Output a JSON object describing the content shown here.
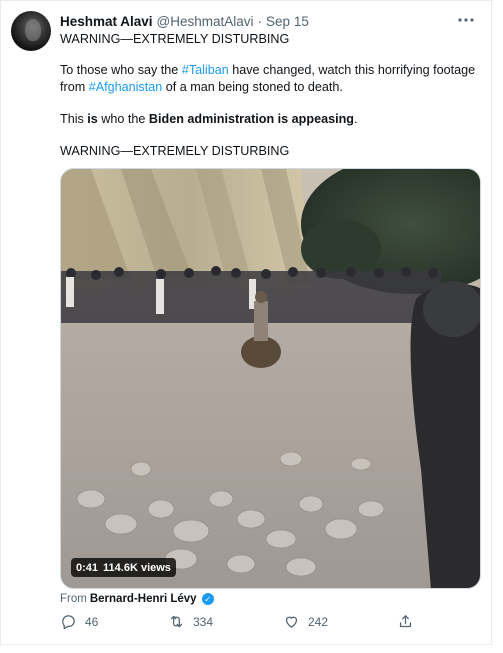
{
  "tweet": {
    "author_name": "Heshmat Alavi",
    "author_handle": "@HeshmatAlavi",
    "separator": "·",
    "date": "Sep 15",
    "more_icon": "more-horizontal-icon",
    "line1": "WARNING—EXTREMELY DISTURBING",
    "para2": {
      "a": "To those who say the ",
      "tag1": "#Taliban",
      "b": " have changed, watch this horrifying footage from ",
      "tag2": "#Afghanistan",
      "c": " of a man being stoned to death."
    },
    "para3": {
      "a": "This ",
      "b": "is",
      "c": " who the ",
      "d": "Biden administration",
      "e": " ",
      "f": "is appeasing",
      "g": "."
    },
    "line4": "WARNING—EXTREMELY DISTURBING",
    "accent": "#1d9bf0"
  },
  "media": {
    "duration": "0:41",
    "views": "114.6K views"
  },
  "source": {
    "prefix": "From",
    "name": "Bernard-Henri Lévy",
    "verified_icon": "verified-badge-icon"
  },
  "actions": {
    "reply_count": "46",
    "retweet_count": "334",
    "like_count": "242",
    "reply_icon": "reply-icon",
    "retweet_icon": "retweet-icon",
    "like_icon": "heart-icon",
    "share_icon": "share-icon"
  }
}
